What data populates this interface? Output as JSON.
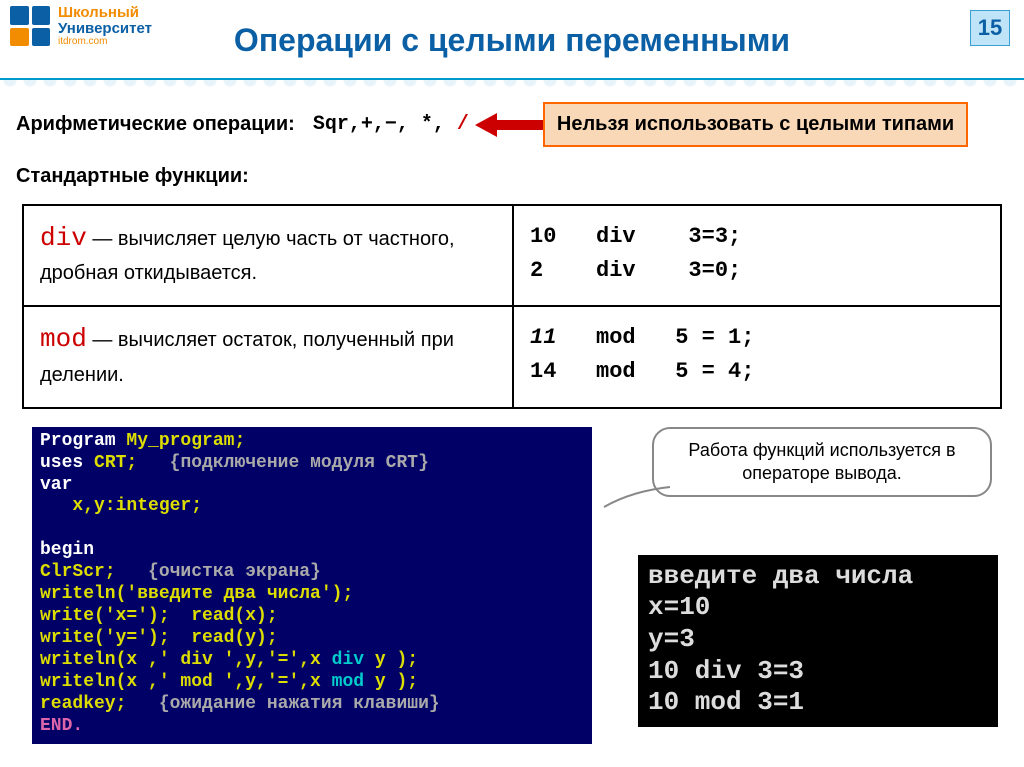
{
  "header": {
    "logo": {
      "line1": "Школьный",
      "line2": "Университет",
      "line3": "itdrom.com"
    },
    "title": "Операции с целыми переменными",
    "page_number": "15"
  },
  "arith": {
    "label": "Арифметические операции:",
    "ops_mono": "Sqr",
    "ops_rest": ",+,−,  *,  ",
    "slash": "/"
  },
  "warn_callout": "Нельзя использовать с целыми типами",
  "subhead": "Стандартные функции:",
  "table": {
    "row_div": {
      "kw": "div",
      "desc": " — вычисляет целую часть от частного, дробная откидывается.",
      "ex": "10   div    3=3;\n2    div    3=0;"
    },
    "row_mod": {
      "kw": "mod",
      "desc": " — вычисляет остаток, полученный при делении.",
      "ex_prefix": "11",
      "ex_rest": "   mod   5 = 1;\n14   mod   5 = 4;"
    }
  },
  "code": {
    "l01a": "Program",
    "l01b": " My_program;",
    "l02a": "uses",
    "l02b": " CRT;   ",
    "l02c": "{подключение модуля CRT}",
    "l03a": "var",
    "l04": "   x,y:integer;",
    "l05": "",
    "l06a": "begin",
    "l07a": "ClrScr;   ",
    "l07b": "{очистка экрана}",
    "l08": "writeln('введите два числа');",
    "l09": "write('x=');  read(x);",
    "l10": "write('y=');  read(y);",
    "l11a": "writeln(x ,' div ',y,'=',x ",
    "l11b": "div",
    "l11c": " y );",
    "l12a": "writeln(x ,' mod ',y,'=',x ",
    "l12b": "mod",
    "l12c": " y );",
    "l13a": "readkey;   ",
    "l13b": "{ожидание нажатия клавиши}",
    "l14a": "END."
  },
  "info_callout": "Работа функций используется в операторе вывода.",
  "output": "введите два числа\nx=10\ny=3\n10 div 3=3\n10 mod 3=1"
}
